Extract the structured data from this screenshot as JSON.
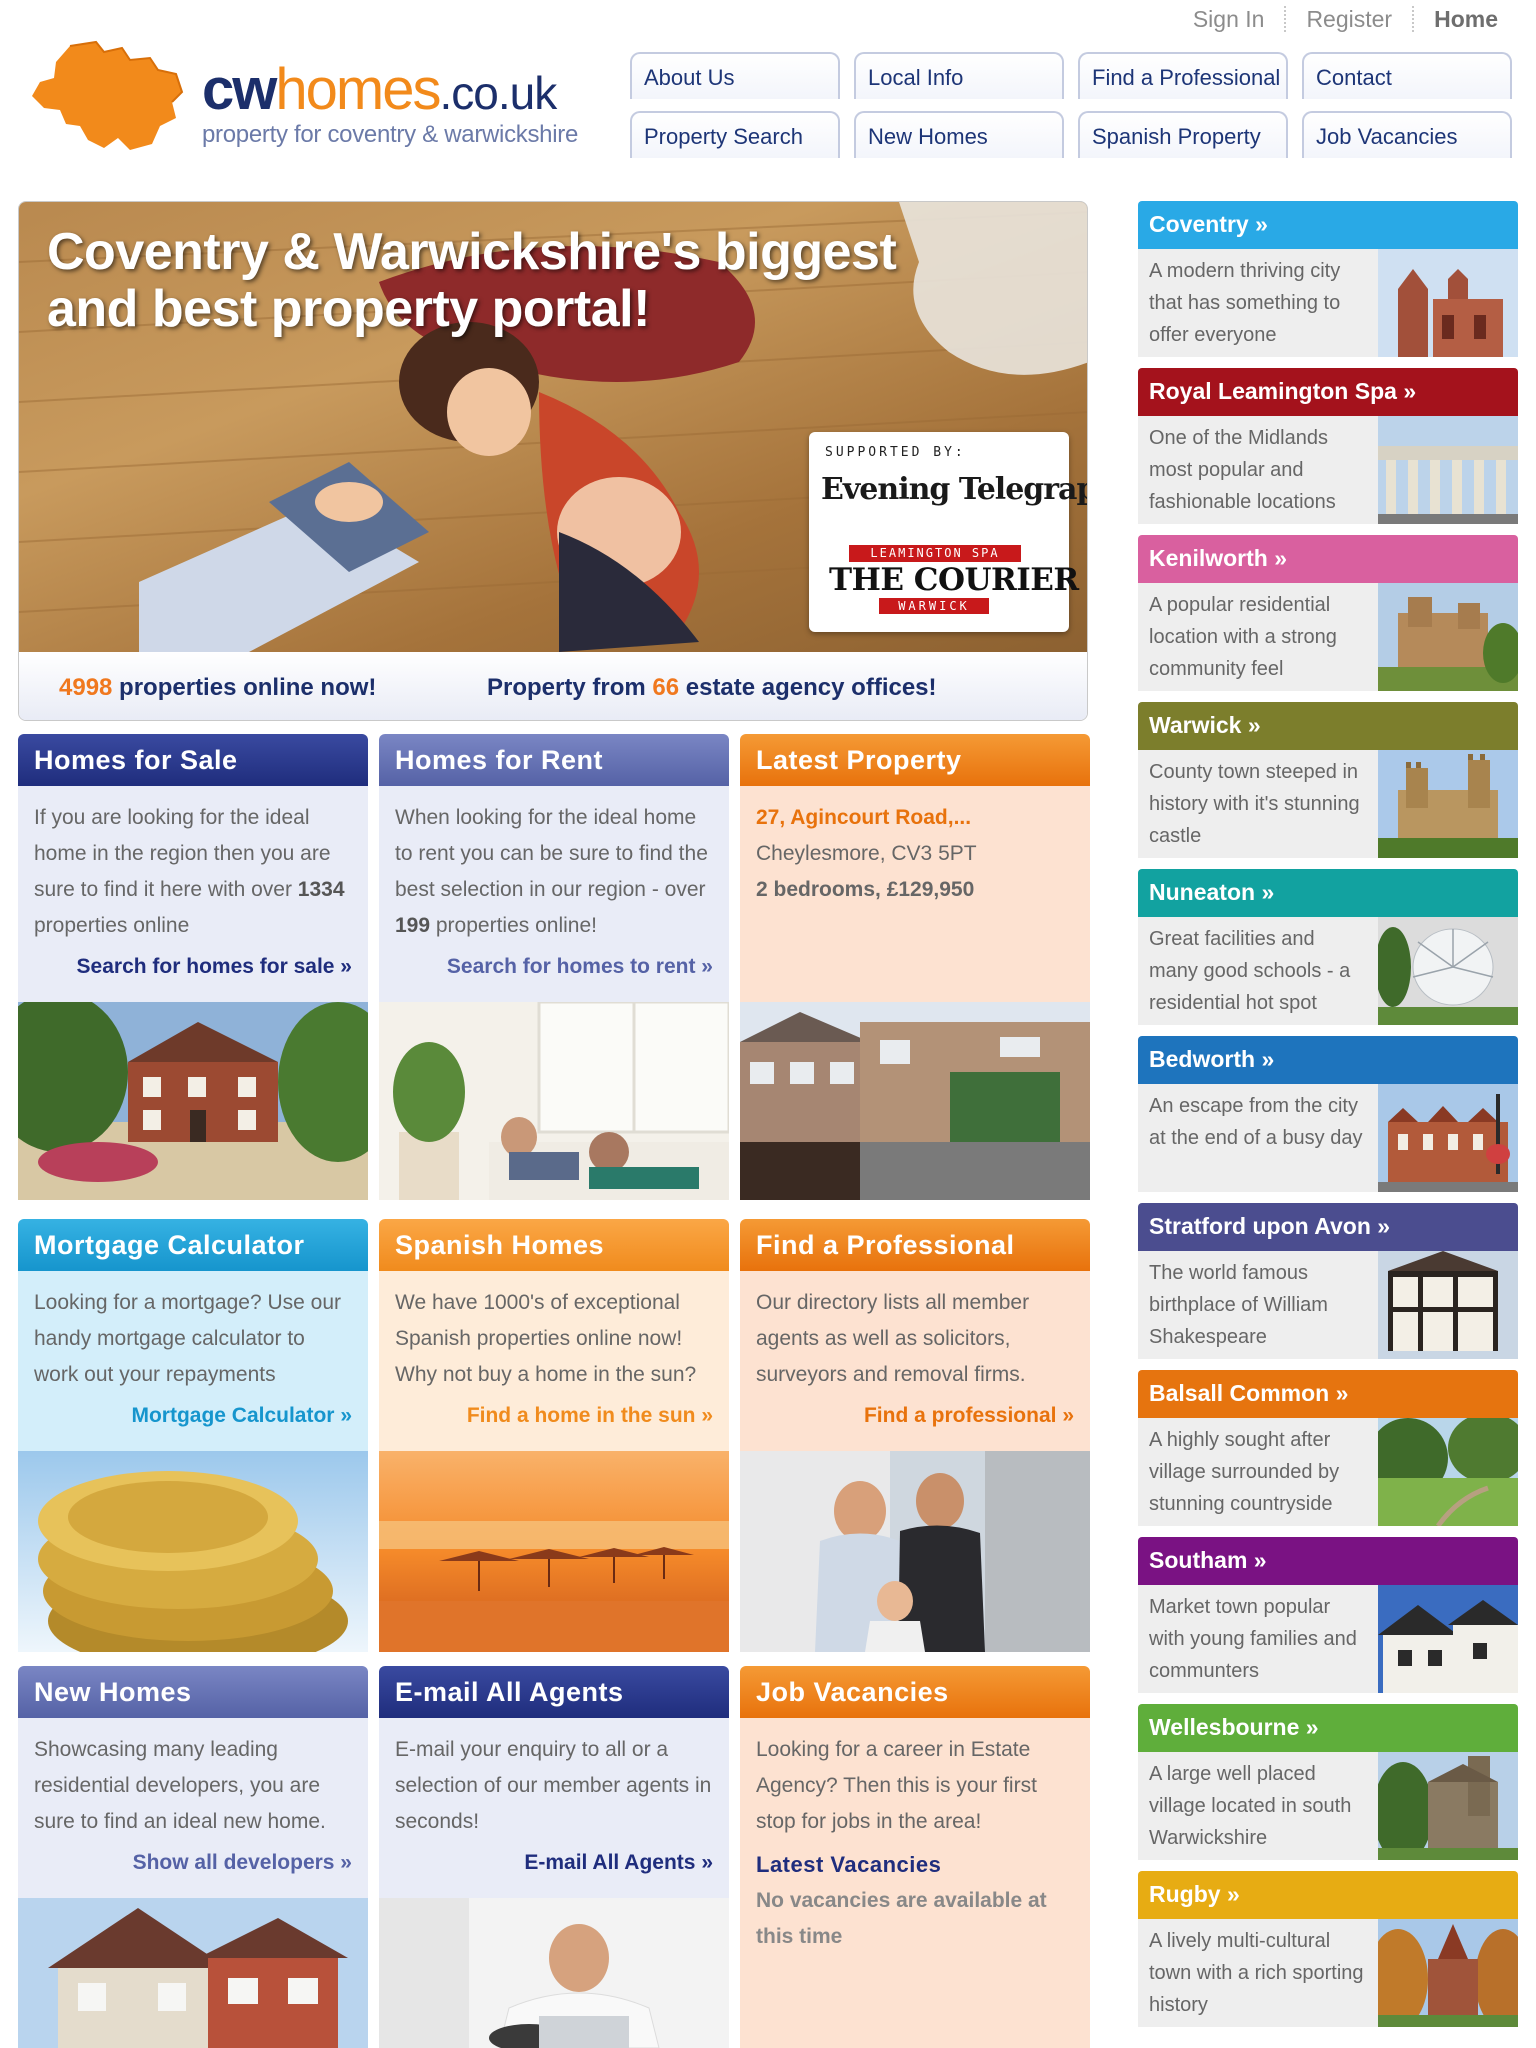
{
  "header": {
    "util_links": [
      "Sign In",
      "Register",
      "Home"
    ],
    "logo": {
      "cw": "cw",
      "homes": "homes",
      "tld": ".co.uk",
      "tagline": "property for coventry & warwickshire"
    },
    "nav_tabs": [
      "About Us",
      "Local Info",
      "Find a Professional",
      "Contact",
      "Property Search",
      "New Homes",
      "Spanish Property",
      "Job Vacancies"
    ]
  },
  "hero": {
    "title_line1": "Coventry & Warwickshire's biggest",
    "title_line2": "and best property portal!",
    "supported_by": "SUPPORTED BY:",
    "sponsor1": "Evening Telegraph",
    "sponsor2_top": "LEAMINGTON SPA",
    "sponsor2": "THE COURIER",
    "sponsor2_bottom": "WARWICK",
    "stats": {
      "properties": "4998",
      "properties_text": " properties online now!",
      "offices_prefix": "Property from ",
      "offices": "66",
      "offices_text": " estate agency offices!"
    }
  },
  "boxes": {
    "sale": {
      "title": "Homes for Sale",
      "text_pre": "If you are looking for the ideal home in the region then you are sure to find it here with over ",
      "count": "1334",
      "text_post": " properties online",
      "link": "Search for homes for sale »"
    },
    "rent": {
      "title": "Homes for Rent",
      "text_pre": "When looking for the ideal home to rent you can be sure to find the best selection in our region - over ",
      "count": "199",
      "text_post": " properties online!",
      "link": "Search for homes to rent »"
    },
    "latest": {
      "title": "Latest Property",
      "address": "27, Agincourt Road,...",
      "area": "Cheylesmore, CV3 5PT",
      "details": "2 bedrooms, £129,950"
    },
    "mortgage": {
      "title": "Mortgage Calculator",
      "text": "Looking for a mortgage? Use our handy mortgage calculator to work out your repayments",
      "link": "Mortgage Calculator »"
    },
    "spanish": {
      "title": "Spanish Homes",
      "text": "We have 1000's of exceptional Spanish properties online now! Why not buy a home in the sun?",
      "link": "Find a home in the sun »"
    },
    "professional": {
      "title": "Find a Professional",
      "text": "Our directory lists all member agents as well as solicitors, surveyors and removal firms.",
      "link": "Find a professional »"
    },
    "newhomes": {
      "title": "New Homes",
      "text": "Showcasing many leading residential developers, you are sure to find an ideal new home.",
      "link": "Show all developers »"
    },
    "email": {
      "title": "E-mail All Agents",
      "text": "E-mail your enquiry to all or a selection of our member agents in seconds!",
      "link": "E-mail All Agents »"
    },
    "jobs": {
      "title": "Job Vacancies",
      "text": "Looking for a career in Estate Agency? Then this is your first stop for jobs in the area!",
      "sub": "Latest Vacancies",
      "none": "No vacancies are available at this time"
    }
  },
  "sidebar": [
    {
      "title": "Coventry »",
      "text": "A modern thriving city that has something to offer everyone",
      "color": "#29a9e6"
    },
    {
      "title": "Royal Leamington Spa »",
      "text": "One of the Midlands most popular and fashionable locations",
      "color": "#a4121c"
    },
    {
      "title": "Kenilworth »",
      "text": "A popular residential location with a strong community feel",
      "color": "#d9609f"
    },
    {
      "title": "Warwick »",
      "text": "County town steeped in history with it's stunning castle",
      "color": "#7c7e2c"
    },
    {
      "title": "Nuneaton »",
      "text": "Great facilities and many good schools - a residential hot spot",
      "color": "#12a2a0"
    },
    {
      "title": "Bedworth »",
      "text": "An escape from the city at the end of a busy day",
      "color": "#1e74bd"
    },
    {
      "title": "Stratford upon Avon »",
      "text": "The world famous birthplace of William Shakespeare",
      "color": "#4b4d8f"
    },
    {
      "title": "Balsall Common »",
      "text": "A highly sought after village surrounded by stunning countryside",
      "color": "#e6740f"
    },
    {
      "title": "Southam »",
      "text": "Market town popular with young families and communters",
      "color": "#7a1283"
    },
    {
      "title": "Wellesbourne »",
      "text": "A large well placed village located in south Warwickshire",
      "color": "#5fae3b"
    },
    {
      "title": "Rugby »",
      "text": "A lively multi-cultural town with a rich sporting history",
      "color": "#e7ac13"
    }
  ]
}
